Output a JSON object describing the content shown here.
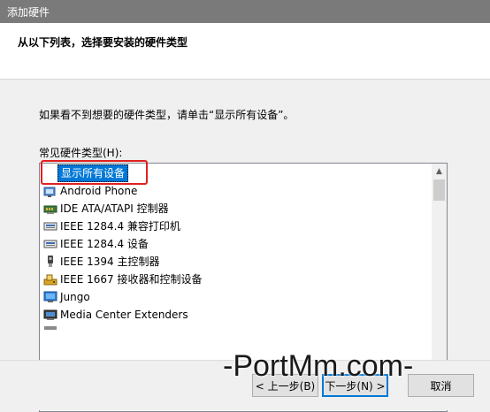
{
  "window": {
    "title": "添加硬件"
  },
  "header": {
    "heading": "从以下列表，选择要安装的硬件类型"
  },
  "content": {
    "instruction": "如果看不到想要的硬件类型，请单击“显示所有设备”。",
    "list_label": "常见硬件类型(H):",
    "items": [
      {
        "label": "显示所有设备",
        "icon": "none",
        "selected": true
      },
      {
        "label": "Android Phone",
        "icon": "device-icon"
      },
      {
        "label": "IDE ATA/ATAPI 控制器",
        "icon": "ide-controller-icon"
      },
      {
        "label": "IEEE 1284.4 兼容打印机",
        "icon": "printer-port-icon"
      },
      {
        "label": "IEEE 1284.4 设备",
        "icon": "printer-port-icon"
      },
      {
        "label": "IEEE 1394 主控制器",
        "icon": "firewire-icon"
      },
      {
        "label": "IEEE 1667 接收器和控制设备",
        "icon": "receiver-icon"
      },
      {
        "label": "Jungo",
        "icon": "monitor-icon"
      },
      {
        "label": "Media Center Extenders",
        "icon": "media-center-icon"
      }
    ]
  },
  "footer": {
    "back_label": "< 上一步(B)",
    "next_label": "下一步(N) >",
    "cancel_label": "取消"
  },
  "watermark": "-PortMm.com-",
  "colors": {
    "selection": "#0078d7",
    "highlight_box": "#e02020",
    "titlebar": "#7a7a7a"
  }
}
